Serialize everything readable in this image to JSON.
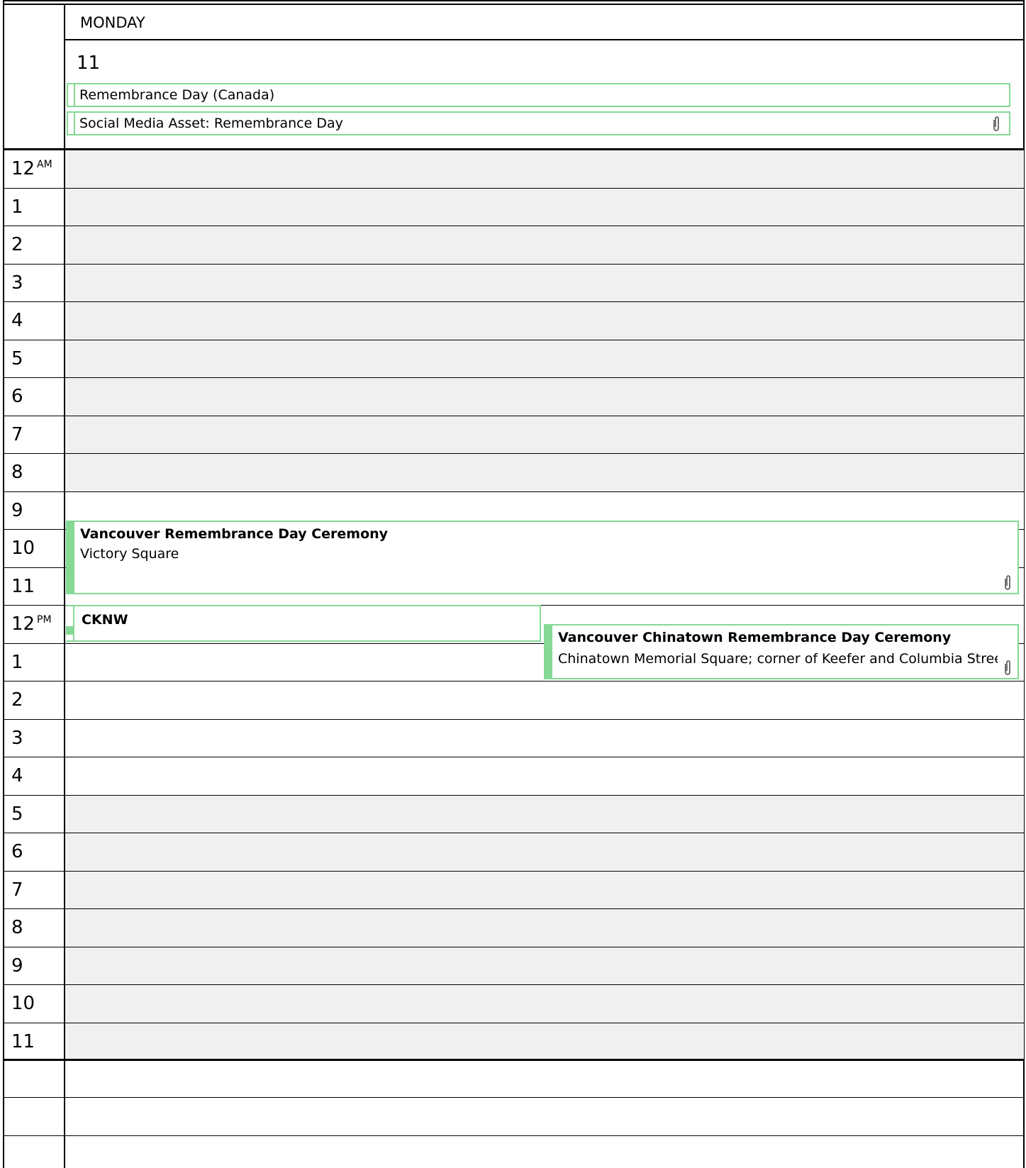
{
  "header": {
    "day_name": "MONDAY",
    "day_number": "11"
  },
  "all_day_events": [
    {
      "title": "Remembrance Day (Canada)",
      "has_attachment": false
    },
    {
      "title": "Social Media Asset: Remembrance Day",
      "has_attachment": true
    }
  ],
  "hours": [
    "12",
    "1",
    "2",
    "3",
    "4",
    "5",
    "6",
    "7",
    "8",
    "9",
    "10",
    "11",
    "12",
    "1",
    "2",
    "3",
    "4",
    "5",
    "6",
    "7",
    "8",
    "9",
    "10",
    "11"
  ],
  "am_label": "AM",
  "pm_label": "PM",
  "events": [
    {
      "title": "Vancouver Remembrance Day Ceremony",
      "location": "Victory Square",
      "has_attachment": true
    },
    {
      "title": "CKNW",
      "location": "",
      "has_attachment": false
    },
    {
      "title": "Vancouver Chinatown Remembrance Day Ceremony",
      "location": "Chinatown Memorial Square; corner of Keefer and Columbia Stree",
      "has_attachment": true
    }
  ],
  "colors": {
    "accent": "#86d895",
    "off_hours": "#f0f0f0",
    "grid": "#000000"
  }
}
